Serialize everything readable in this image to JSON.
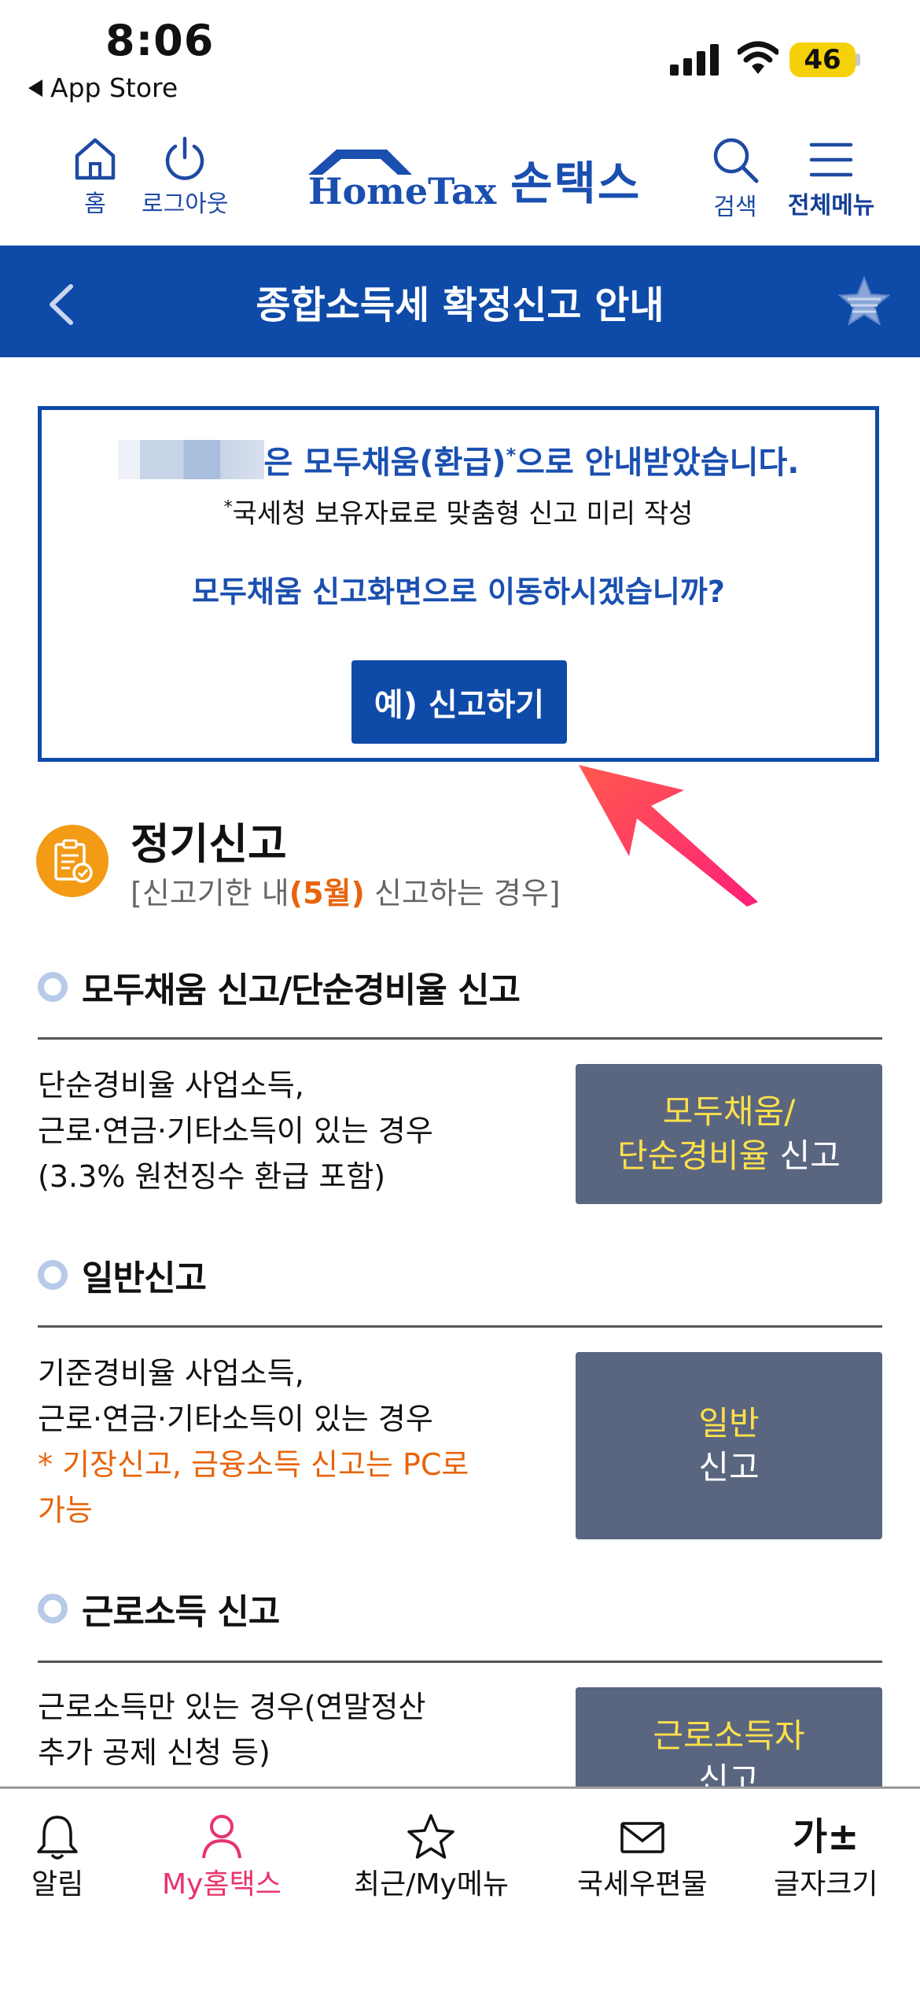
{
  "status_bar": {
    "time": "8:06",
    "back_app": "App Store",
    "battery": "46"
  },
  "header": {
    "home_label": "홈",
    "logout_label": "로그아웃",
    "logo_en": "HomeTax",
    "logo_kr": "손택스",
    "search_label": "검색",
    "menu_label": "전체메뉴"
  },
  "title_bar": {
    "title": "종합소득세 확정신고 안내"
  },
  "notice": {
    "line1": "은 모두채움(환급)",
    "line1_mark": "*",
    "line1_tail": "으로 안내받았습니다.",
    "line2_mark": "*",
    "line2": "국세청 보유자료로 맞춤형 신고 미리 작성",
    "line3": "모두채움 신고화면으로 이동하시겠습니까?",
    "button": "예) 신고하기"
  },
  "regular": {
    "title": "정기신고",
    "sub_pre": "[신고기한 내",
    "sub_hl": "(5월)",
    "sub_post": " 신고하는 경우]"
  },
  "sections": [
    {
      "heading": "모두채움 신고/단순경비율 신고",
      "desc": [
        "단순경비율 사업소득,",
        "근로·연금·기타소득이 있는 경우",
        "(3.3% 원천징수 환급 포함)"
      ],
      "card_y1": "모두채움/",
      "card_y2": "단순경비율",
      "card_w2": " 신고"
    },
    {
      "heading": "일반신고",
      "desc": [
        "기준경비율 사업소득,",
        "근로·연금·기타소득이 있는 경우"
      ],
      "warn": [
        "* 기장신고, 금융소득 신고는 PC로",
        "가능"
      ],
      "card_y1": "일반",
      "card_w2": "신고"
    },
    {
      "heading": "근로소득 신고",
      "desc": [
        "근로소득만 있는 경우(연말정산",
        "추가 공제 신청 등)"
      ],
      "card_y1": "근로소득자",
      "card_w2": "신고"
    }
  ],
  "tabs": [
    {
      "label": "알림"
    },
    {
      "label": "My홈택스"
    },
    {
      "label": "최근/My메뉴"
    },
    {
      "label": "국세우편물"
    },
    {
      "label": "글자크기",
      "glyph": "가±"
    }
  ],
  "colors": {
    "primary": "#0e4aa8",
    "accent": "#e8640c",
    "card": "#5a6680",
    "active_tab": "#e8336b"
  }
}
